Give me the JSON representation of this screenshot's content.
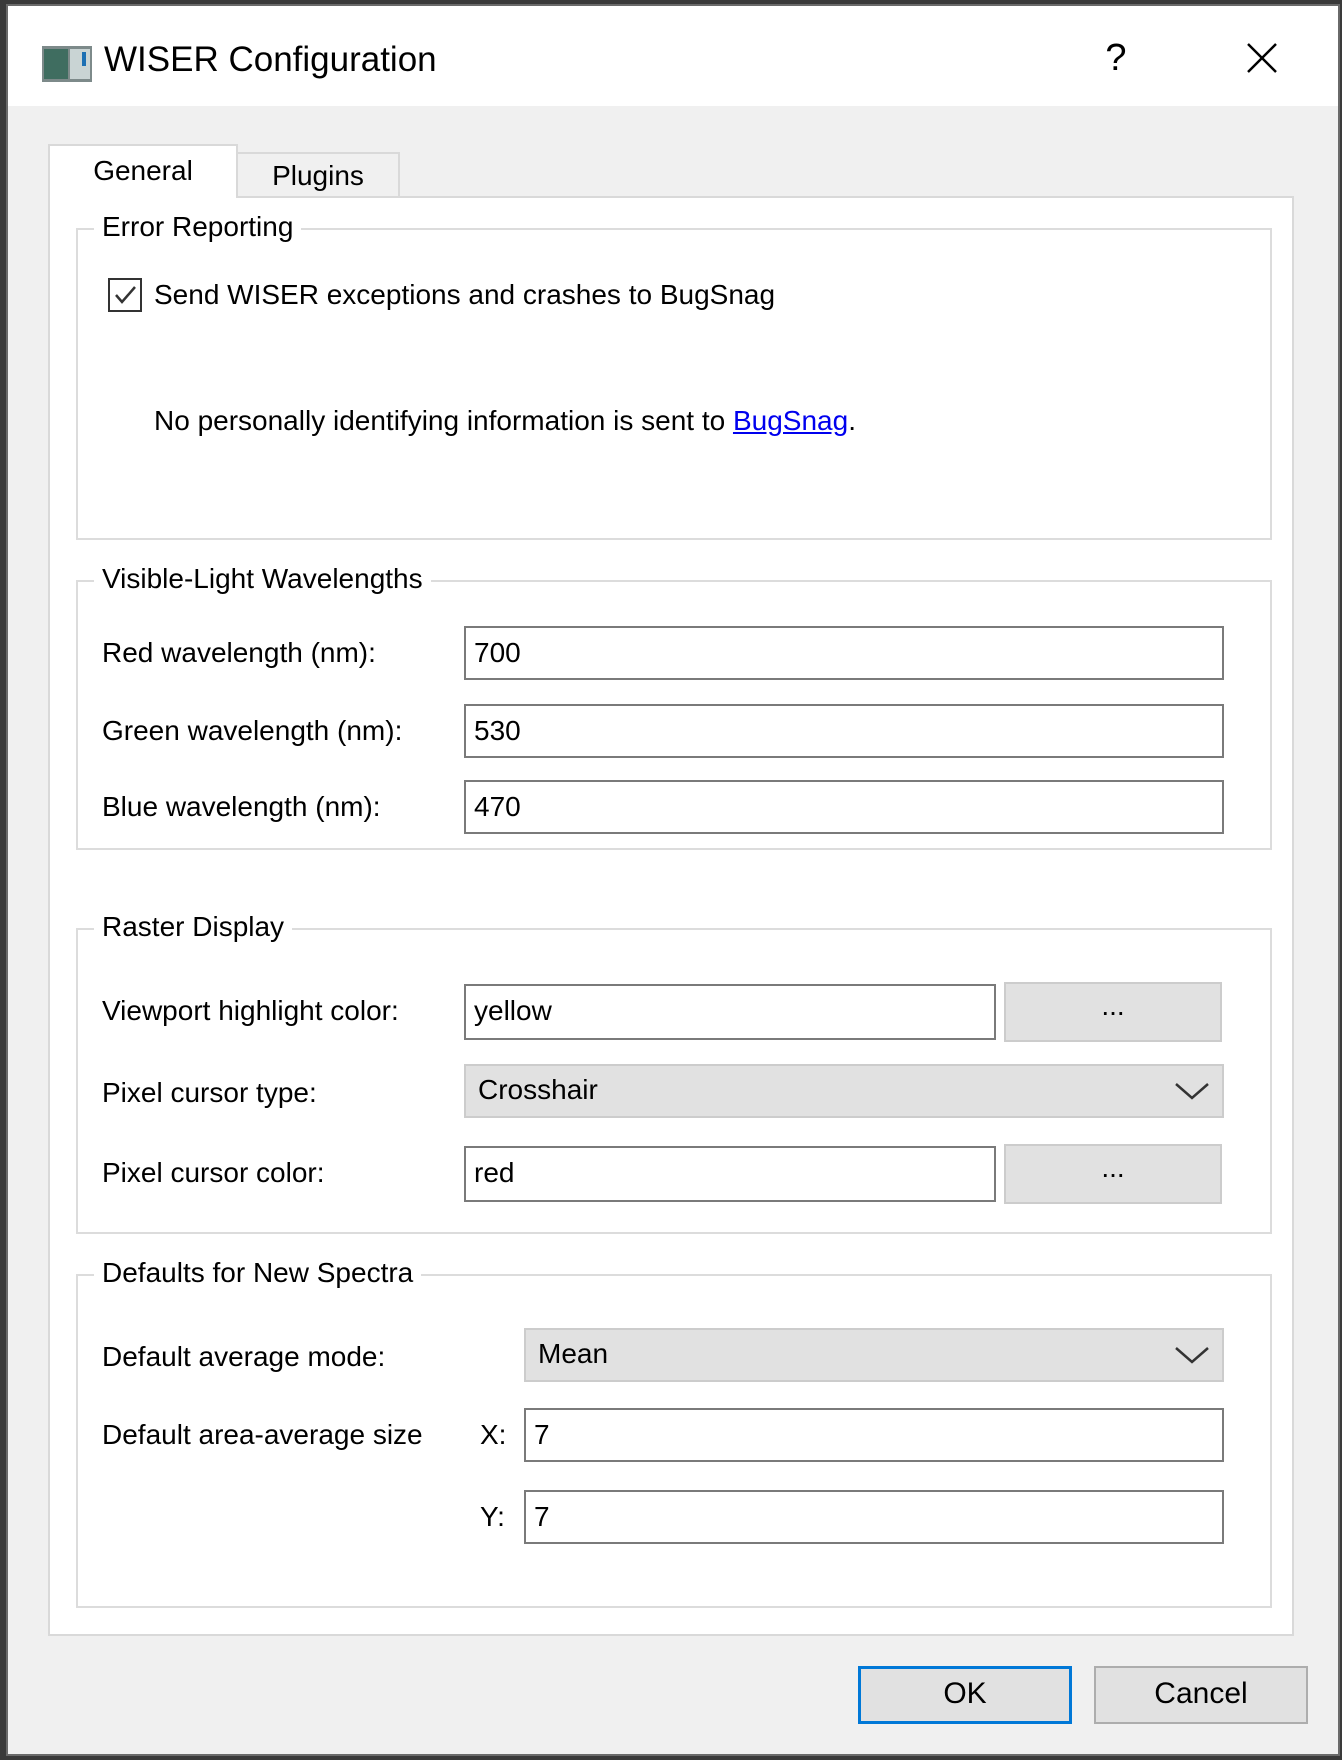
{
  "window": {
    "title": "WISER Configuration",
    "help_label": "?",
    "icons": {
      "app": "app-window-icon",
      "close": "close-icon"
    }
  },
  "tabs": [
    {
      "label": "General",
      "active": true
    },
    {
      "label": "Plugins",
      "active": false
    }
  ],
  "error_reporting": {
    "title": "Error Reporting",
    "checkbox_label": "Send WISER exceptions and crashes to BugSnag",
    "checked": true,
    "info_prefix": "No personally identifying information is sent to ",
    "info_link": "BugSnag",
    "info_suffix": "."
  },
  "wavelengths": {
    "title": "Visible-Light Wavelengths",
    "red_label": "Red wavelength (nm):",
    "red_value": "700",
    "green_label": "Green wavelength (nm):",
    "green_value": "530",
    "blue_label": "Blue wavelength (nm):",
    "blue_value": "470"
  },
  "raster": {
    "title": "Raster Display",
    "highlight_label": "Viewport highlight color:",
    "highlight_value": "yellow",
    "highlight_button": "...",
    "cursor_type_label": "Pixel cursor type:",
    "cursor_type_value": "Crosshair",
    "cursor_color_label": "Pixel cursor color:",
    "cursor_color_value": "red",
    "cursor_color_button": "..."
  },
  "spectra": {
    "title": "Defaults for New Spectra",
    "avg_mode_label": "Default average mode:",
    "avg_mode_value": "Mean",
    "area_size_label": "Default area-average size",
    "x_label": "X:",
    "x_value": "7",
    "y_label": "Y:",
    "y_value": "7"
  },
  "buttons": {
    "ok": "OK",
    "cancel": "Cancel"
  },
  "colors": {
    "accent": "#0078d7",
    "link": "#0000ee"
  }
}
